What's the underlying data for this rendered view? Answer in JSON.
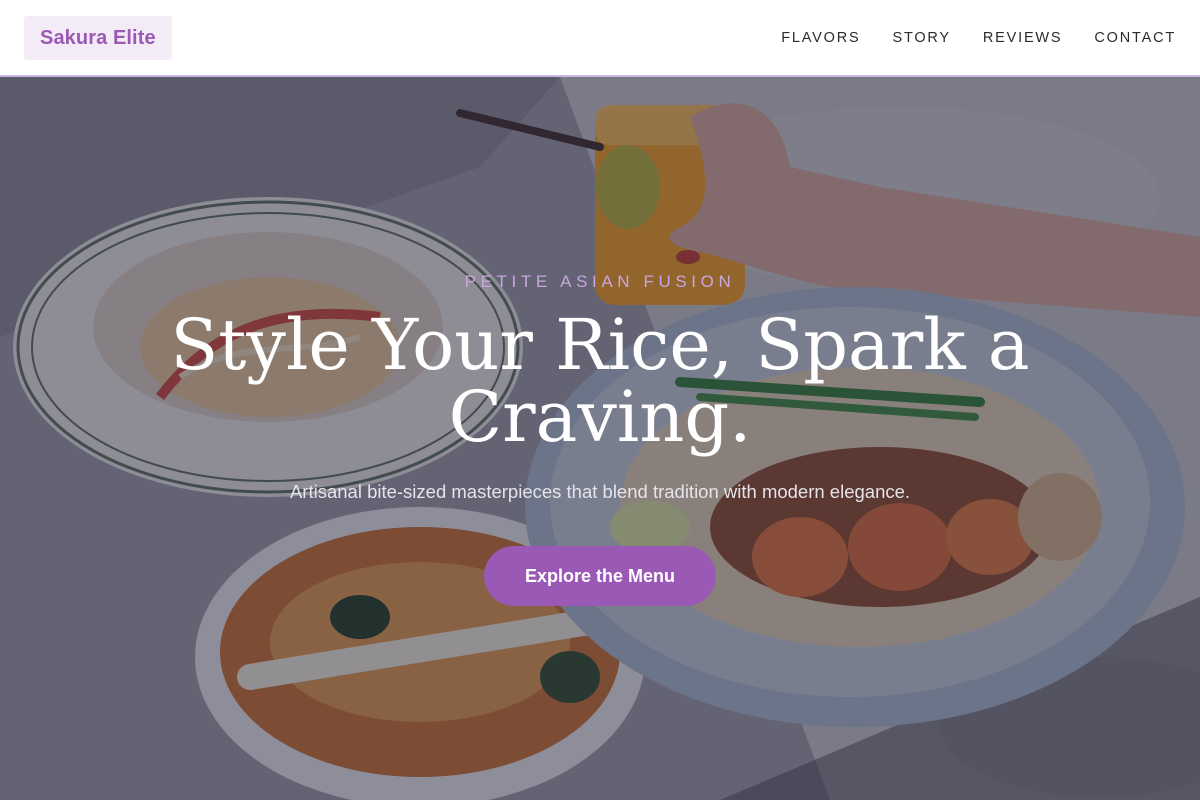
{
  "brand": {
    "name": "Sakura Elite",
    "accent": "#9b59b6"
  },
  "nav": {
    "items": [
      {
        "label": "FLAVORS"
      },
      {
        "label": "STORY"
      },
      {
        "label": "REVIEWS"
      },
      {
        "label": "CONTACT"
      }
    ]
  },
  "hero": {
    "eyebrow": "PETITE ASIAN FUSION",
    "headline": "Style Your Rice, Spark a Craving.",
    "subtitle": "Artisanal bite-sized masterpieces that blend tradition with modern elegance.",
    "cta_label": "Explore the Menu"
  }
}
